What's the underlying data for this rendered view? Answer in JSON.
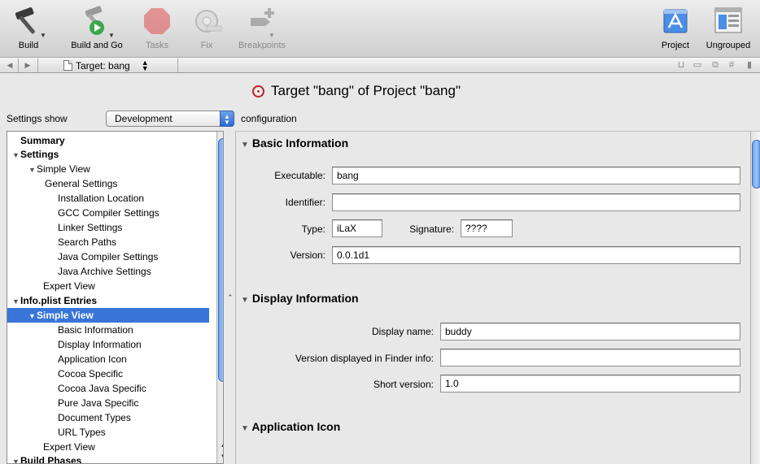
{
  "toolbar": {
    "build": "Build",
    "build_and_go": "Build and Go",
    "tasks": "Tasks",
    "fix": "Fix",
    "breakpoints": "Breakpoints",
    "project": "Project",
    "ungrouped": "Ungrouped"
  },
  "pathbar": {
    "target": "Target: bang"
  },
  "title": "Target \"bang\" of Project \"bang\"",
  "settings_row": {
    "label": "Settings show",
    "configuration": "Development",
    "suffix": "configuration"
  },
  "sidebar": {
    "items": [
      {
        "label": "Summary"
      },
      {
        "label": "Settings"
      },
      {
        "label": "Simple View"
      },
      {
        "label": "General Settings"
      },
      {
        "label": "Installation Location"
      },
      {
        "label": "GCC Compiler Settings"
      },
      {
        "label": "Linker Settings"
      },
      {
        "label": "Search Paths"
      },
      {
        "label": "Java Compiler Settings"
      },
      {
        "label": "Java Archive Settings"
      },
      {
        "label": "Expert View"
      },
      {
        "label": "Info.plist Entries"
      },
      {
        "label": "Simple View"
      },
      {
        "label": "Basic Information"
      },
      {
        "label": "Display Information"
      },
      {
        "label": "Application Icon"
      },
      {
        "label": "Cocoa Specific"
      },
      {
        "label": "Cocoa Java Specific"
      },
      {
        "label": "Pure Java Specific"
      },
      {
        "label": "Document Types"
      },
      {
        "label": "URL Types"
      },
      {
        "label": "Expert View"
      },
      {
        "label": "Build Phases"
      }
    ]
  },
  "basic": {
    "heading": "Basic Information",
    "executable_label": "Executable:",
    "executable": "bang",
    "identifier_label": "Identifier:",
    "identifier": "",
    "type_label": "Type:",
    "type": "iLaX",
    "signature_label": "Signature:",
    "signature": "????",
    "version_label": "Version:",
    "version": "0.0.1d1"
  },
  "display": {
    "heading": "Display Information",
    "display_name_label": "Display name:",
    "display_name": "buddy",
    "finder_label": "Version displayed in Finder info:",
    "finder": "",
    "short_label": "Short version:",
    "short": "1.0"
  },
  "app_icon": {
    "heading": "Application Icon"
  },
  "colors": {
    "selection": "#3875d7",
    "target_icon": "#c0202a"
  }
}
